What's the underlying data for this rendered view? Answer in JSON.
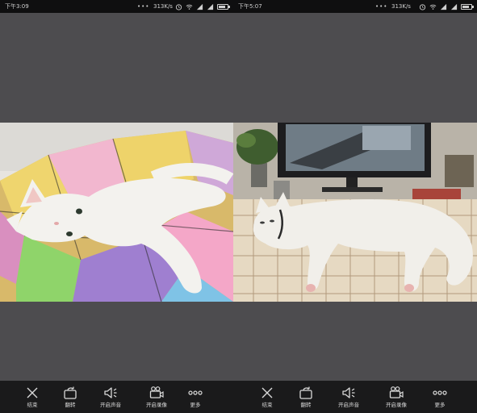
{
  "left_screen": {
    "status": {
      "time": "下午3:09",
      "signal_dots": "•••",
      "speed": "313K/s"
    },
    "toolbar": [
      {
        "label": "结束",
        "icon": "close-icon"
      },
      {
        "label": "翻转",
        "icon": "flip-camera-icon"
      },
      {
        "label": "开启声音",
        "icon": "speaker-icon"
      },
      {
        "label": "开启录像",
        "icon": "video-camera-icon"
      },
      {
        "label": "更多",
        "icon": "more-icon"
      }
    ]
  },
  "right_screen": {
    "status": {
      "time": "下午5:07",
      "signal_dots": "•••",
      "speed": "313K/s"
    },
    "toolbar": [
      {
        "label": "结束",
        "icon": "close-icon"
      },
      {
        "label": "翻转",
        "icon": "flip-camera-icon"
      },
      {
        "label": "开启声音",
        "icon": "speaker-icon"
      },
      {
        "label": "开启录像",
        "icon": "video-camera-icon"
      },
      {
        "label": "更多",
        "icon": "more-icon"
      }
    ]
  },
  "colors": {
    "panel_background": "#4d4c4f",
    "status_bar": "#0f0f10",
    "toolbar": "#1a1a1b",
    "toolbar_text": "#d9d9d9"
  }
}
